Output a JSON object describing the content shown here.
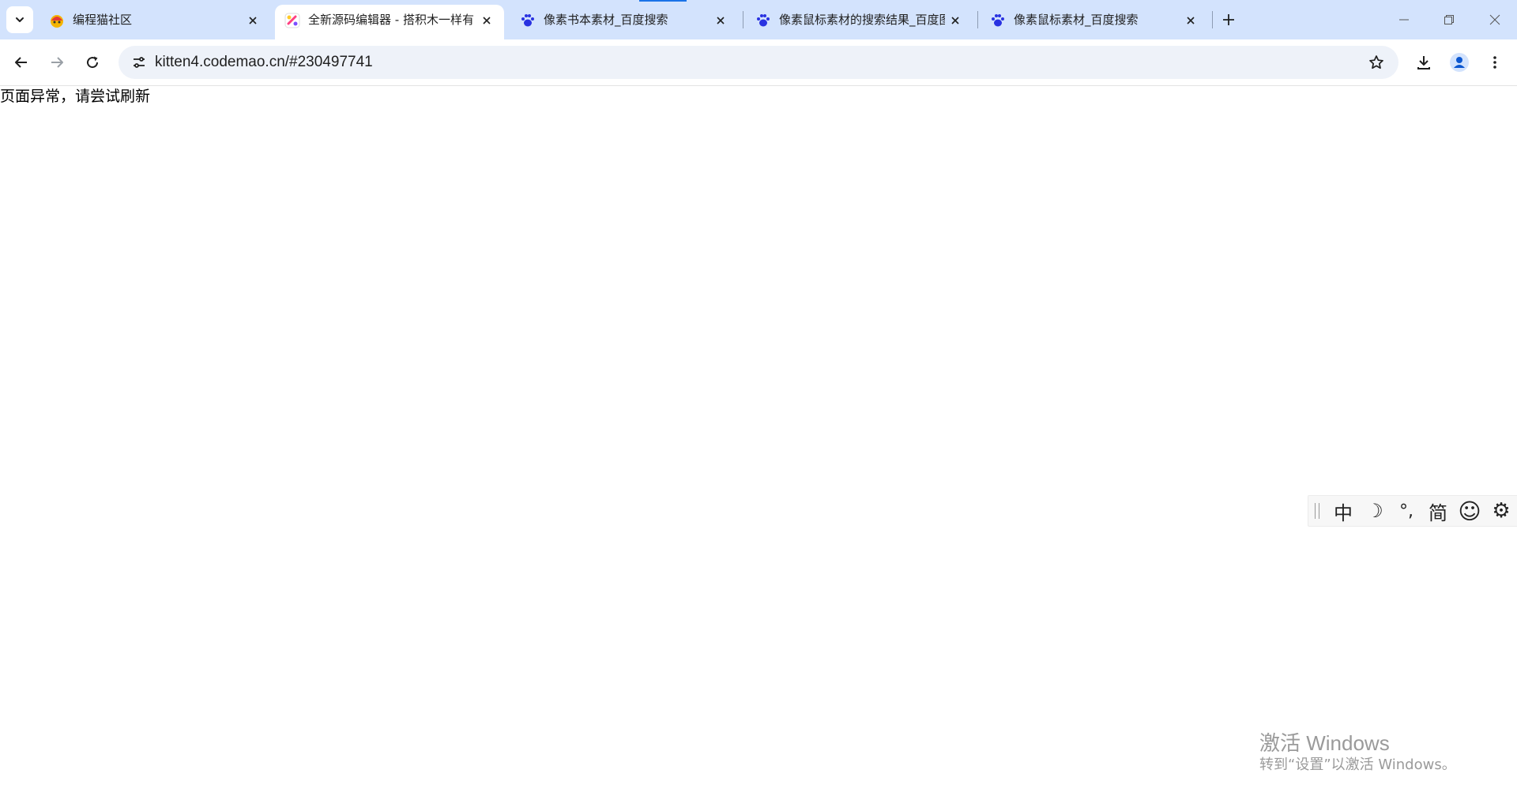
{
  "tabs": [
    {
      "title": "编程猫社区",
      "active": false,
      "favicon": "codemao-community-icon"
    },
    {
      "title": "全新源码编辑器 - 搭积木一样有",
      "active": true,
      "favicon": "kitten-editor-icon"
    },
    {
      "title": "像素书本素材_百度搜索",
      "active": false,
      "favicon": "baidu-paw-icon"
    },
    {
      "title": "像素鼠标素材的搜索结果_百度图",
      "active": false,
      "favicon": "baidu-paw-icon"
    },
    {
      "title": "像素鼠标素材_百度搜索",
      "active": false,
      "favicon": "baidu-paw-icon"
    }
  ],
  "toolbar": {
    "url": "kitten4.codemao.cn/#230497741"
  },
  "page": {
    "message": "页面异常，请尝试刷新"
  },
  "ime": {
    "mode": "中",
    "moon": "☽",
    "punct": "°,",
    "script": "简",
    "emoji": "☺",
    "settings": "⚙"
  },
  "watermark": {
    "title": "激活 Windows",
    "subtitle": "转到“设置”以激活 Windows。"
  },
  "colors": {
    "tabstrip": "#d3e3fd",
    "omnibox": "#eef2f9",
    "accent": "#1a73e8"
  }
}
